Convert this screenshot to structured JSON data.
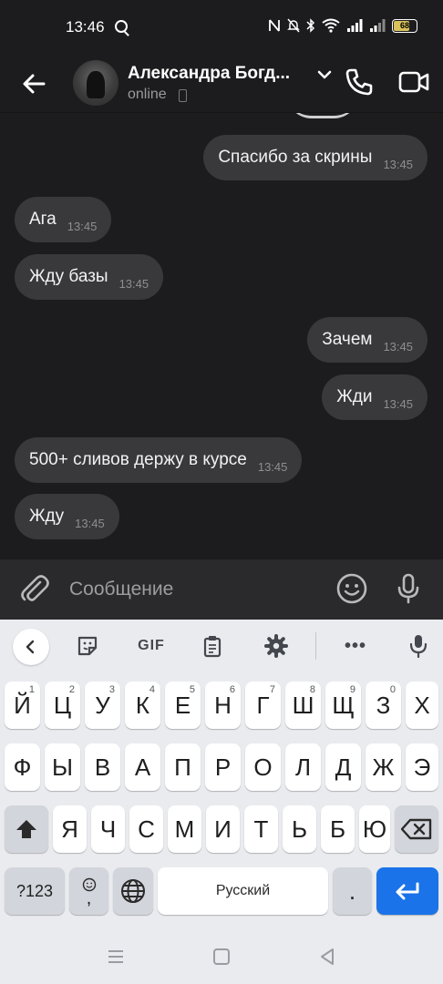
{
  "status_bar": {
    "time": "13:46",
    "battery": "68",
    "icons": [
      "nfc-icon",
      "mute-icon",
      "bluetooth-icon",
      "wifi-icon",
      "signal-icon",
      "signal-icon",
      "battery-icon"
    ]
  },
  "header": {
    "contact_name": "Александра Богд...",
    "status": "online"
  },
  "messages": [
    {
      "text": "Спасибо за скрины",
      "time": "13:45",
      "side": "out"
    },
    {
      "text": "Ага",
      "time": "13:45",
      "side": "in"
    },
    {
      "text": "Жду базы",
      "time": "13:45",
      "side": "in"
    },
    {
      "text": "Зачем",
      "time": "13:45",
      "side": "out"
    },
    {
      "text": "Жди",
      "time": "13:45",
      "side": "out"
    },
    {
      "text": "500+ сливов держу в курсе",
      "time": "13:45",
      "side": "in"
    },
    {
      "text": "Жду",
      "time": "13:45",
      "side": "in"
    }
  ],
  "composer": {
    "placeholder": "Сообщение"
  },
  "keyboard": {
    "toolbar": {
      "gif_label": "GIF",
      "more_label": "•••"
    },
    "row1": [
      {
        "k": "Й",
        "s": "1"
      },
      {
        "k": "Ц",
        "s": "2"
      },
      {
        "k": "У",
        "s": "3"
      },
      {
        "k": "К",
        "s": "4"
      },
      {
        "k": "Е",
        "s": "5"
      },
      {
        "k": "Н",
        "s": "6"
      },
      {
        "k": "Г",
        "s": "7"
      },
      {
        "k": "Ш",
        "s": "8"
      },
      {
        "k": "Щ",
        "s": "9"
      },
      {
        "k": "З",
        "s": "0"
      },
      {
        "k": "Х",
        "s": ""
      }
    ],
    "row2": [
      "Ф",
      "Ы",
      "В",
      "А",
      "П",
      "Р",
      "О",
      "Л",
      "Д",
      "Ж",
      "Э"
    ],
    "row3": [
      "Я",
      "Ч",
      "С",
      "М",
      "И",
      "Т",
      "Ь",
      "Б",
      "Ю"
    ],
    "row4": {
      "sym": "?123",
      "comma": ",",
      "space": "Русский",
      "period": "."
    },
    "accent_color": "#1a73e8"
  }
}
